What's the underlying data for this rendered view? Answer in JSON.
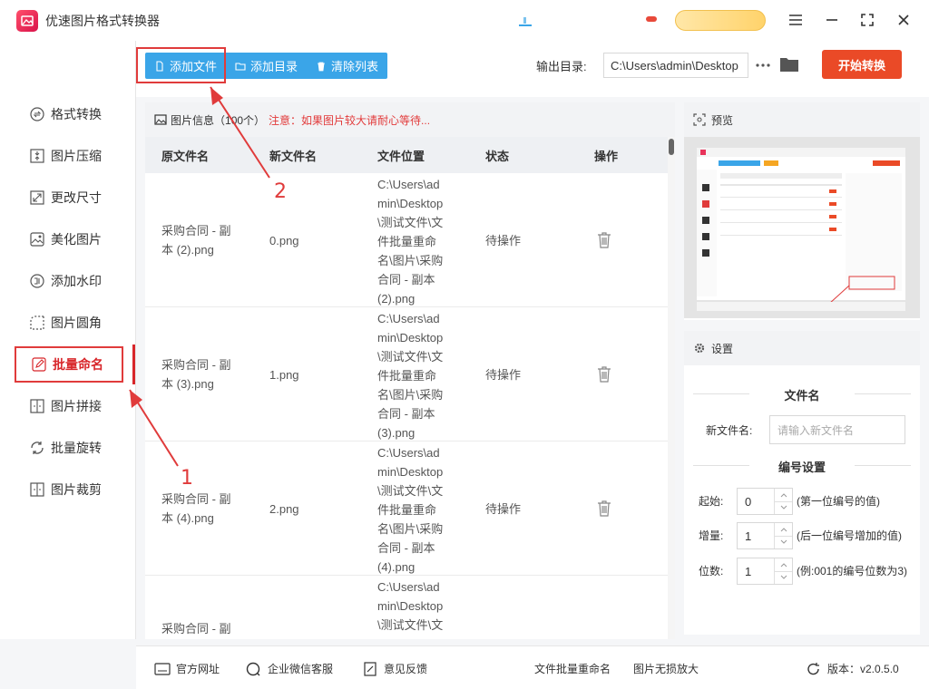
{
  "app": {
    "title": "优速图片格式转换器"
  },
  "sidebar": {
    "items": [
      {
        "label": "格式转换",
        "icon": "format-convert-icon"
      },
      {
        "label": "图片压缩",
        "icon": "compress-icon"
      },
      {
        "label": "更改尺寸",
        "icon": "resize-icon"
      },
      {
        "label": "美化图片",
        "icon": "beautify-icon"
      },
      {
        "label": "添加水印",
        "icon": "watermark-icon"
      },
      {
        "label": "图片圆角",
        "icon": "rounded-corner-icon"
      },
      {
        "label": "批量命名",
        "icon": "rename-icon"
      },
      {
        "label": "图片拼接",
        "icon": "stitch-icon"
      },
      {
        "label": "批量旋转",
        "icon": "rotate-icon"
      },
      {
        "label": "图片裁剪",
        "icon": "crop-icon"
      }
    ],
    "active_index": 6
  },
  "toolbar": {
    "add_file": "添加文件",
    "add_dir": "添加目录",
    "clear_list": "清除列表",
    "output_label": "输出目录:",
    "output_path": "C:\\Users\\admin\\Desktop",
    "start": "开始转换"
  },
  "file_panel": {
    "title": "图片信息",
    "count": "（100个）",
    "notice": "注意：如果图片较大请耐心等待...",
    "columns": [
      "原文件名",
      "新文件名",
      "文件位置",
      "状态",
      "操作"
    ],
    "rows": [
      {
        "original": [
          "采购合同 - 副",
          "本 (2).png"
        ],
        "new_name": "0.png",
        "location": [
          "C:\\Users\\ad",
          "min\\Desktop",
          "\\测试文件\\文",
          "件批量重命",
          "名\\图片\\采购",
          "合同 - 副本",
          "(2).png"
        ],
        "status": "待操作"
      },
      {
        "original": [
          "采购合同 - 副",
          "本 (3).png"
        ],
        "new_name": "1.png",
        "location": [
          "C:\\Users\\ad",
          "min\\Desktop",
          "\\测试文件\\文",
          "件批量重命",
          "名\\图片\\采购",
          "合同 - 副本",
          "(3).png"
        ],
        "status": "待操作"
      },
      {
        "original": [
          "采购合同 - 副",
          "本 (4).png"
        ],
        "new_name": "2.png",
        "location": [
          "C:\\Users\\ad",
          "min\\Desktop",
          "\\测试文件\\文",
          "件批量重命",
          "名\\图片\\采购",
          "合同 - 副本",
          "(4).png"
        ],
        "status": "待操作"
      },
      {
        "original": [
          "采购合同 - 副",
          ""
        ],
        "new_name": "",
        "location": [
          "C:\\Users\\ad",
          "min\\Desktop",
          "\\测试文件\\文",
          "",
          "",
          "",
          ""
        ],
        "status": ""
      }
    ]
  },
  "preview": {
    "title": "预览"
  },
  "settings": {
    "title": "设置",
    "filename_section": "文件名",
    "new_name_label": "新文件名:",
    "new_name_placeholder": "请输入新文件名",
    "numbering_section": "编号设置",
    "start_label": "起始:",
    "start_value": "0",
    "start_hint": "(第一位编号的值)",
    "step_label": "增量:",
    "step_value": "1",
    "step_hint": "(后一位编号增加的值)",
    "digits_label": "位数:",
    "digits_value": "1",
    "digits_hint": "(例:001的编号位数为3)"
  },
  "footer": {
    "website": "官方网址",
    "wechat": "企业微信客服",
    "feedback": "意见反馈",
    "link1": "文件批量重命名",
    "link2": "图片无损放大",
    "version": "版本：v2.0.5.0"
  },
  "annotations": {
    "one": "1",
    "two": "2"
  },
  "colors": {
    "accent_red": "#ea4a27",
    "tool_blue": "#3aa5e8",
    "annotation_red": "#e03b3b"
  }
}
